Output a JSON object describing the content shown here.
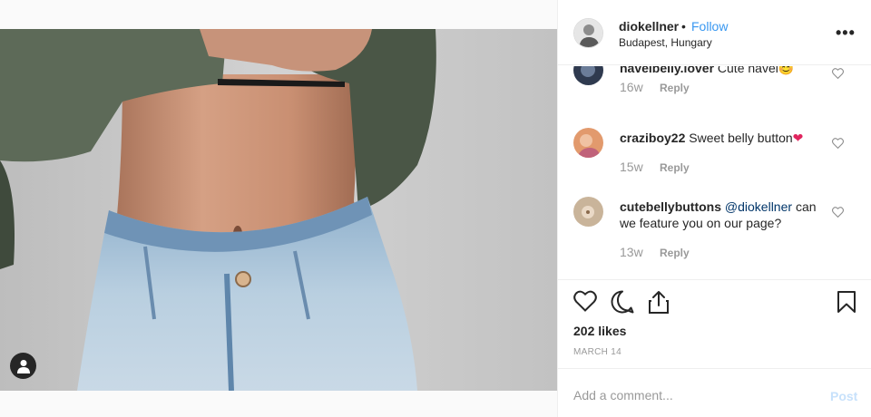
{
  "post": {
    "username": "diokellner",
    "separator": "•",
    "follow_label": "Follow",
    "location": "Budapest, Hungary",
    "more_label": "•••"
  },
  "comments": [
    {
      "user": "navelbelly.lover",
      "text": "Cute navel",
      "emoji": "😊",
      "age": "16w",
      "reply": "Reply"
    },
    {
      "user": "craziboy22",
      "text": "Sweet belly button",
      "emoji": "❤",
      "age": "15w",
      "reply": "Reply"
    },
    {
      "user": "cutebellybuttons",
      "mention": "@diokellner",
      "text": "can we feature you on our page?",
      "age": "13w",
      "reply": "Reply"
    }
  ],
  "actions": {
    "like_icon": "heart-outline-icon",
    "comment_icon": "speech-bubble-icon",
    "share_icon": "share-arrow-icon",
    "save_icon": "bookmark-icon"
  },
  "likes": "202 likes",
  "date": "MARCH 14",
  "add_comment": {
    "placeholder": "Add a comment...",
    "post_label": "Post"
  },
  "colors": {
    "accent": "#3897f0",
    "text": "#262626",
    "muted": "#999999",
    "post_disabled": "#c7e1fb",
    "border": "#efefef",
    "mention": "#003569"
  }
}
